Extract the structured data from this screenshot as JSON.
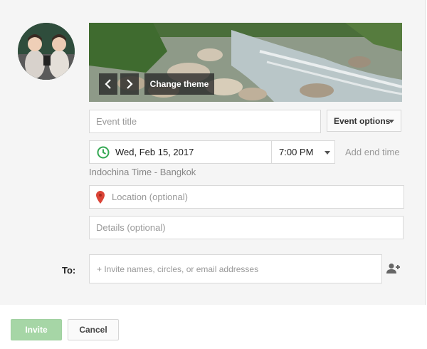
{
  "theme": {
    "change_label": "Change theme",
    "prev_icon": "chevron-left-icon",
    "next_icon": "chevron-right-icon"
  },
  "form": {
    "title_placeholder": "Event title",
    "options_label": "Event options",
    "date_value": "Wed, Feb 15, 2017",
    "time_value": "7:00 PM",
    "end_time_label": "Add end time",
    "timezone": "Indochina Time - Bangkok",
    "location_placeholder": "Location (optional)",
    "details_placeholder": "Details (optional)",
    "to_label": "To:",
    "invite_placeholder": "+ Invite names, circles, or email addresses"
  },
  "actions": {
    "invite_label": "Invite",
    "cancel_label": "Cancel"
  },
  "colors": {
    "clock": "#34a853",
    "pin": "#db4437",
    "invite_button": "#a6d6a6"
  }
}
